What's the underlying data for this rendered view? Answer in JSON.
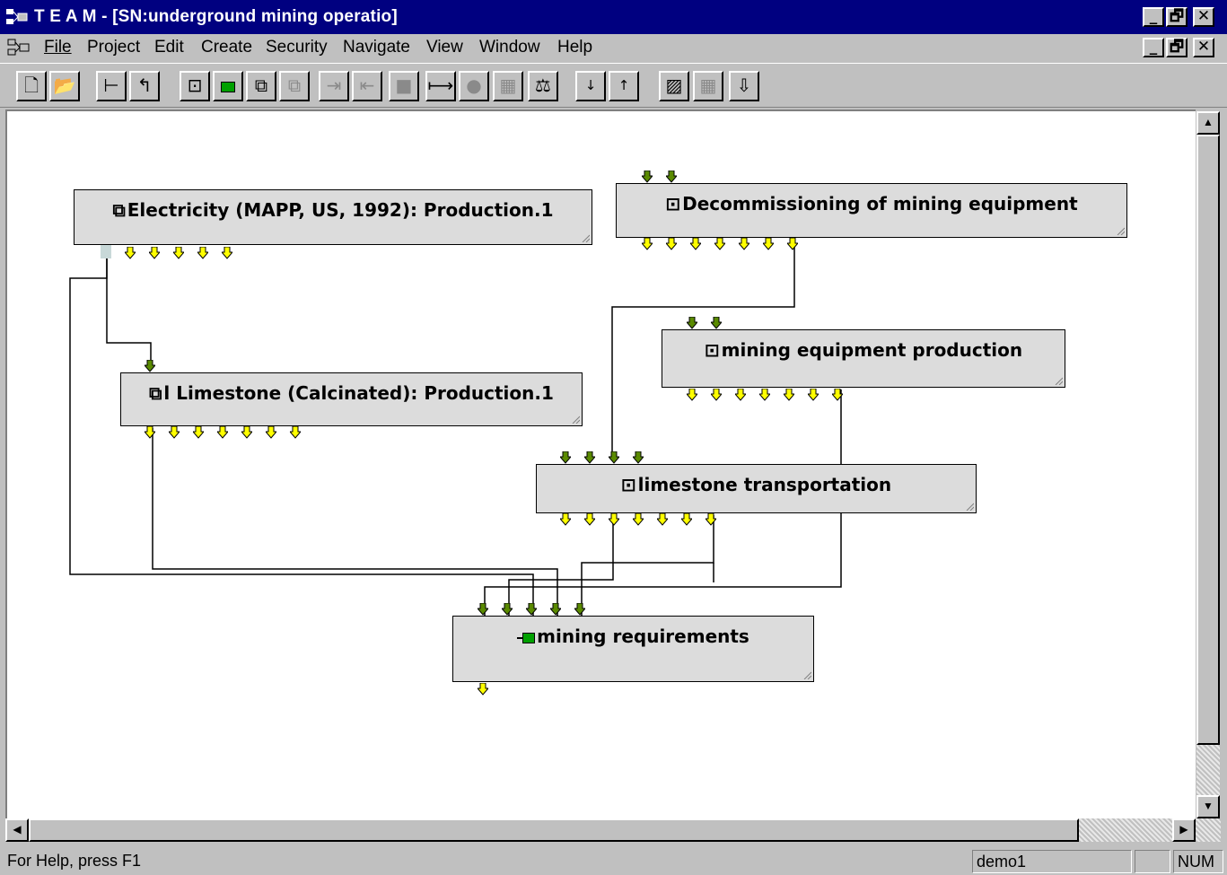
{
  "window": {
    "title": "T E A M - [SN:underground mining operatio]",
    "caption_buttons": [
      "_",
      "🗗",
      "✕"
    ]
  },
  "menu": {
    "items": [
      "File",
      "Project",
      "Edit",
      "Create",
      "Security",
      "Navigate",
      "View",
      "Window",
      "Help"
    ],
    "mdi_buttons": [
      "_",
      "🗗",
      "✕"
    ]
  },
  "toolbar": {
    "buttons": [
      {
        "icon": "new-document-icon",
        "glyph": "🗋",
        "enabled": true
      },
      {
        "icon": "open-folder-icon",
        "glyph": "📂",
        "enabled": true
      },
      {
        "icon": "tree-view-icon",
        "glyph": "⊢",
        "enabled": true
      },
      {
        "icon": "up-level-icon",
        "glyph": "↰",
        "enabled": true
      },
      {
        "icon": "module-icon",
        "glyph": "⊡",
        "enabled": true
      },
      {
        "icon": "green-module-icon",
        "glyph": "",
        "enabled": true
      },
      {
        "icon": "stacked-module-icon",
        "glyph": "⧉",
        "enabled": true
      },
      {
        "icon": "stacked-module-disabled-icon",
        "glyph": "⧉",
        "enabled": false
      },
      {
        "icon": "arrow-in-icon",
        "glyph": "⇥",
        "enabled": false
      },
      {
        "icon": "arrow-out-icon",
        "glyph": "⇤",
        "enabled": false
      },
      {
        "icon": "block-icon",
        "glyph": "■",
        "enabled": false
      },
      {
        "icon": "connect-icon",
        "glyph": "⟼",
        "enabled": true
      },
      {
        "icon": "gear-icon",
        "glyph": "●",
        "enabled": false
      },
      {
        "icon": "calculator-icon",
        "glyph": "▦",
        "enabled": false
      },
      {
        "icon": "balance-icon",
        "glyph": "⚖",
        "enabled": true
      },
      {
        "icon": "lock-down-icon",
        "glyph": "↓🔒",
        "enabled": true
      },
      {
        "icon": "lock-up-icon",
        "glyph": "↑🔒",
        "enabled": true
      },
      {
        "icon": "chart-icon",
        "glyph": "▨",
        "enabled": true
      },
      {
        "icon": "grid-icon",
        "glyph": "▦",
        "enabled": false
      },
      {
        "icon": "down-arrow-icon",
        "glyph": "⇩",
        "enabled": true
      }
    ]
  },
  "diagram": {
    "nodes": [
      {
        "id": "electricity",
        "icon": "stacked-module-icon",
        "icon_glyph": "⧉",
        "label": "Electricity (MAPP, US, 1992): Production.1",
        "inputs": 0,
        "outputs": 5
      },
      {
        "id": "decommissioning",
        "icon": "module-icon",
        "icon_glyph": "⊡",
        "label": "Decommissioning of mining equipment",
        "inputs": 2,
        "outputs": 7
      },
      {
        "id": "mining-equipment-production",
        "icon": "module-icon",
        "icon_glyph": "⊡",
        "label": "mining equipment production",
        "inputs": 2,
        "outputs": 7
      },
      {
        "id": "limestone",
        "icon": "stacked-module-icon",
        "icon_glyph": "⧉",
        "label": "l Limestone (Calcinated): Production.1",
        "inputs": 1,
        "outputs": 7
      },
      {
        "id": "limestone-transportation",
        "icon": "module-icon",
        "icon_glyph": "⊡",
        "label": "limestone transportation",
        "inputs": 4,
        "outputs": 7
      },
      {
        "id": "mining-requirements",
        "icon": "green-module-icon",
        "icon_glyph": "",
        "label": "mining requirements",
        "inputs": 5,
        "outputs": 1
      }
    ],
    "colors": {
      "connected_flow": "#5a8a00",
      "open_flow": "#ffff00",
      "node_fill": "#dcdcdc"
    }
  },
  "scroll": {
    "up": "▲",
    "down": "▼",
    "left": "◀",
    "right": "▶"
  },
  "status": {
    "help": "For Help, press F1",
    "user": "demo1",
    "blank": "",
    "num": "NUM"
  }
}
